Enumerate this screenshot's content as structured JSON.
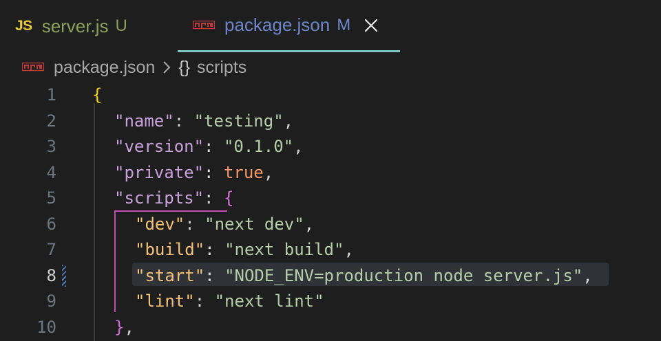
{
  "tabs": [
    {
      "icon": "js-icon",
      "badge": "JS",
      "name": "server.js",
      "status": "U"
    },
    {
      "icon": "npm-icon",
      "name": "package.json",
      "status": "M"
    }
  ],
  "breadcrumb": {
    "file": "package.json",
    "braces": "{}",
    "symbol": "scripts"
  },
  "line_numbers": [
    "1",
    "2",
    "3",
    "4",
    "5",
    "6",
    "7",
    "8",
    "9",
    "10"
  ],
  "code": {
    "l1_open": "{",
    "name_key": "\"name\"",
    "name_val": "\"testing\"",
    "version_key": "\"version\"",
    "version_val": "\"0.1.0\"",
    "private_key": "\"private\"",
    "private_val": "true",
    "scripts_key": "\"scripts\"",
    "scripts_open": "{",
    "dev_key": "\"dev\"",
    "dev_val": "\"next dev\"",
    "build_key": "\"build\"",
    "build_val": "\"next build\"",
    "start_key": "\"start\"",
    "start_val_a": "\"NODE_ENV=production",
    "start_val_b": "node",
    "start_val_c": "server.js\"",
    "lint_key": "\"lint\"",
    "lint_val": "\"next lint\"",
    "scripts_close": "}",
    "colon": ": ",
    "comma": ","
  },
  "colors": {
    "accent_tab_underline": "#7ec7c4",
    "untracked": "#8fa05a",
    "modified": "#6d85c9",
    "bracket_guide": "#c04fb3"
  }
}
